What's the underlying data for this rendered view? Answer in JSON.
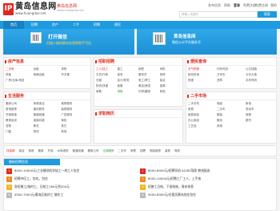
{
  "header": {
    "logo_mark": "IP",
    "site_name": "黄岛信息网",
    "site_url": "www.huangdao.net",
    "city_name": "黄岛信息网",
    "city_sub": "www.huangdao.net",
    "top_links": [
      "发布信息",
      "帮助",
      "登录",
      "免费注册"
    ],
    "top_right": [
      "免费注册",
      "我的"
    ],
    "search_placeholder": "请输入关键字",
    "search_button": "搜索"
  },
  "nav": {
    "items": [
      "首页",
      "招聘",
      "房产",
      "二手",
      "招聘",
      "便民",
      "",
      "",
      "",
      "",
      "",
      ""
    ],
    "active_index": 0
  },
  "banners": {
    "left": {
      "title": "打开微信",
      "subtitle": "扫描二维码黄岛信息网到手可达"
    },
    "right": {
      "title": "黄岛信息网",
      "subtitle": "微信公众平台服务号"
    }
  },
  "panels": {
    "house": {
      "title": "房产信息",
      "items": [
        "二手房",
        "出租",
        "求购",
        "求租",
        "商铺出租",
        "写字楼",
        "厂房/仓库/地皮",
        "",
        "",
        "",
        "",
        ""
      ]
    },
    "service": {
      "title": "生活服务",
      "items": [
        "搬家公司",
        "家政保洁",
        "维修服务",
        "家电维修",
        "婚庆服务",
        "装修服务",
        "开锁换锁",
        "管道疏通",
        "广告服务",
        "教育培训",
        "保姆月嫂",
        "驾校",
        "宠物",
        "鲜花",
        "其它",
        "门窗",
        "物流",
        "其他"
      ]
    },
    "jobs": {
      "title": "招职招聘",
      "items": [
        "工人/技工",
        "普工",
        "销售",
        "司机",
        "文员/行政",
        "保安",
        "服务员",
        "厨师",
        "仓管",
        "会计/财务",
        "电工/焊工",
        "保洁",
        "物流/快递",
        "客服",
        "美容/美发",
        "保姆",
        "家教",
        "网络",
        "外贸/翻译",
        "其他"
      ]
    },
    "resume": {
      "title": "求职简历",
      "items": []
    },
    "convenience": {
      "title": "便民查询",
      "items": [
        "天气预报",
        "列车时刻",
        "公交线路",
        "航班查询",
        "万年历",
        "今天大事",
        "快递",
        "违章",
        "手机号码"
      ]
    },
    "second": {
      "title": "二手市场",
      "items": [
        "二手手机",
        "电脑",
        "家电",
        "家具",
        "二手车",
        "电动车",
        "家居用品",
        "服装",
        "母婴",
        "办公用品",
        "数码",
        "图书",
        "工艺品",
        "其他"
      ]
    }
  },
  "keywords": [
    "找保姆",
    "保洁",
    "家政",
    "搬家",
    "开锁",
    "水电维修",
    "管道疏通",
    "搬家公司",
    "空调维修",
    "二手车",
    "家教",
    "招聘",
    "电脑维修",
    "装修",
    "驾校"
  ],
  "jobs_list": {
    "tab": "最新招聘信息",
    "left": [
      {
        "num": "1",
        "text": "6000-10000元/工业缝纫机学徒工一线工人包住"
      },
      {
        "num": "2",
        "text": "招聘冲压工，包吃，包住"
      },
      {
        "num": "3",
        "text": "急招普工/临时工，日结工160元到200元"
      },
      {
        "num": "4",
        "text": "4500-7000元/黄岛区临时工 操作工"
      }
    ],
    "right": [
      {
        "num": "1",
        "text": "6000-8000元/招聘司机 A2/B2驾照 物流配送"
      },
      {
        "num": "2",
        "text": "6000-10000元/招聘工厂工人，上手快"
      },
      {
        "num": "3",
        "text": "招普工日结，下班结账，周末休息"
      },
      {
        "num": "4",
        "text": "5000-6000元/仓管员黄岛包吃包住"
      }
    ]
  }
}
